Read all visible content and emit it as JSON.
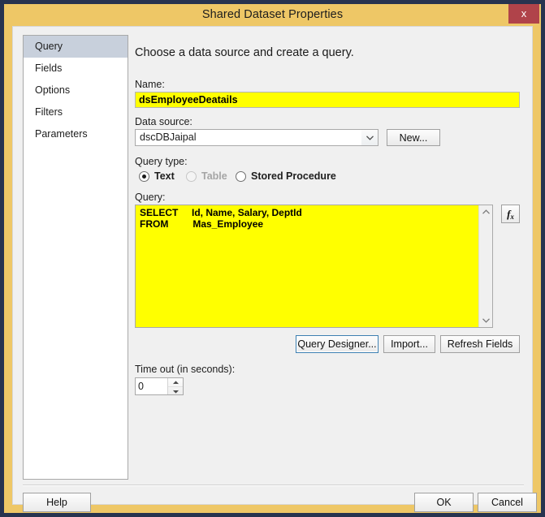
{
  "window": {
    "title": "Shared Dataset Properties",
    "close_label": "x",
    "frame_color": "#eec766",
    "outer_border_color": "#27334f",
    "close_button_color": "#b0434a"
  },
  "sidebar": {
    "items": [
      {
        "label": "Query",
        "selected": true
      },
      {
        "label": "Fields",
        "selected": false
      },
      {
        "label": "Options",
        "selected": false
      },
      {
        "label": "Filters",
        "selected": false
      },
      {
        "label": "Parameters",
        "selected": false
      }
    ],
    "selected_highlight_color": "#c8d0dc"
  },
  "main": {
    "heading": "Choose a data source and create a query.",
    "name": {
      "label": "Name:",
      "value": "dsEmployeeDeatails",
      "field_color": "#ffff00"
    },
    "data_source": {
      "label": "Data source:",
      "selected": "dscDBJaipal",
      "options": [
        "dscDBJaipal"
      ],
      "new_button": "New..."
    },
    "query_type": {
      "label": "Query type:",
      "options": [
        {
          "label": "Text",
          "selected": true,
          "disabled": false
        },
        {
          "label": "Table",
          "selected": false,
          "disabled": true
        },
        {
          "label": "Stored Procedure",
          "selected": false,
          "disabled": false
        }
      ]
    },
    "query": {
      "label": "Query:",
      "text": "SELECT     Id, Name, Salary, DeptId\nFROM         Mas_Employee",
      "field_color": "#ffff00",
      "expression_button": "fx"
    },
    "query_buttons": {
      "query_designer": "Query Designer...",
      "import": "Import...",
      "refresh_fields": "Refresh Fields"
    },
    "timeout": {
      "label": "Time out (in seconds):",
      "value": "0"
    }
  },
  "footer": {
    "help": "Help",
    "ok": "OK",
    "cancel": "Cancel"
  }
}
